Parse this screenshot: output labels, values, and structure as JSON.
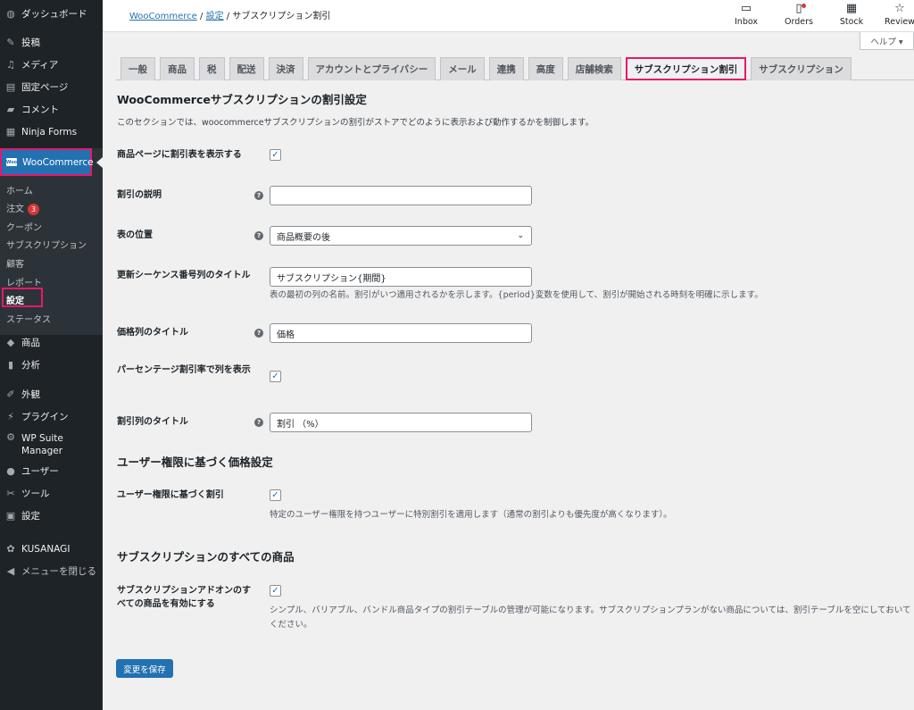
{
  "sidebar": {
    "top_items": [
      {
        "icon": "dashboard-icon",
        "label": "ダッシュボード"
      },
      {
        "icon": "pin-icon",
        "label": "投稿"
      },
      {
        "icon": "media-icon",
        "label": "メディア"
      },
      {
        "icon": "page-icon",
        "label": "固定ページ"
      },
      {
        "icon": "comment-icon",
        "label": "コメント"
      },
      {
        "icon": "forms-icon",
        "label": "Ninja Forms"
      }
    ],
    "woocommerce": {
      "label": "WooCommerce",
      "logo_text": "Woo",
      "submenu": [
        {
          "label": "ホーム"
        },
        {
          "label": "注文",
          "badge": "3"
        },
        {
          "label": "クーポン"
        },
        {
          "label": "サブスクリプション"
        },
        {
          "label": "顧客"
        },
        {
          "label": "レポート"
        },
        {
          "label": "設定",
          "current": true
        },
        {
          "label": "ステータス"
        }
      ]
    },
    "bottom_items": [
      {
        "icon": "products-icon",
        "label": "商品"
      },
      {
        "icon": "analytics-icon",
        "label": "分析"
      },
      {
        "icon": "appearance-icon",
        "label": "外観"
      },
      {
        "icon": "plugin-icon",
        "label": "プラグイン"
      },
      {
        "icon": "wp-suite-icon",
        "label": "WP Suite Manager"
      },
      {
        "icon": "users-icon",
        "label": "ユーザー"
      },
      {
        "icon": "tools-icon",
        "label": "ツール"
      },
      {
        "icon": "settings-icon",
        "label": "設定"
      },
      {
        "icon": "kusanagi-icon",
        "label": "KUSANAGI"
      },
      {
        "icon": "collapse-icon",
        "label": "メニューを閉じる"
      }
    ]
  },
  "topbar": {
    "breadcrumb": {
      "root": "WooCommerce",
      "parent": "設定",
      "current": "サブスクリプション割引",
      "sep": "/"
    },
    "buttons": [
      {
        "icon": "inbox-icon",
        "label": "Inbox"
      },
      {
        "icon": "orders-icon",
        "label": "Orders"
      },
      {
        "icon": "stock-icon",
        "label": "Stock"
      },
      {
        "icon": "star-icon",
        "label": "Review"
      }
    ],
    "help_label": "ヘルプ ▾"
  },
  "tabs": [
    {
      "label": "一般"
    },
    {
      "label": "商品"
    },
    {
      "label": "税"
    },
    {
      "label": "配送"
    },
    {
      "label": "決済"
    },
    {
      "label": "アカウントとプライバシー"
    },
    {
      "label": "メール"
    },
    {
      "label": "連携"
    },
    {
      "label": "高度"
    },
    {
      "label": "店舗検索"
    },
    {
      "label": "サブスクリプション割引",
      "active": true
    },
    {
      "label": "サブスクリプション"
    }
  ],
  "content": {
    "section1_title": "WooCommerceサブスクリプションの割引設定",
    "section1_desc": "このセクションでは、woocommerceサブスクリプションの割引がストアでどのように表示および動作するかを制御します。",
    "show_table_label": "商品ページに割引表を表示する",
    "discount_desc_label": "割引の説明",
    "discount_desc_value": "",
    "table_pos_label": "表の位置",
    "table_pos_value": "商品概要の後",
    "renewal_label": "更新シーケンス番号列のタイトル",
    "renewal_value": "サブスクリプション{期間}",
    "renewal_desc": "表の最初の列の名前。割引がいつ適用されるかを示します。{period}変数を使用して、割引が開始される時刻を明確に示します。",
    "price_col_label": "価格列のタイトル",
    "price_col_value": "価格",
    "percent_label": "パーセンテージ割引率で列を表示",
    "discount_col_label": "割引列のタイトル",
    "discount_col_value": "割引 （%）",
    "section2_title": "ユーザー権限に基づく価格設定",
    "role_label": "ユーザー権限に基づく割引",
    "role_desc": "特定のユーザー権限を持つユーザーに特別割引を適用します（通常の割引よりも優先度が高くなります）。",
    "section3_title": "サブスクリプションのすべての商品",
    "all_products_label": "サブスクリプションアドオンのすべての商品を有効にする",
    "all_products_desc": "シンプル、バリアブル、バンドル商品タイプの割引テーブルの管理が可能になります。サブスクリプションプランがない商品については、割引テーブルを空にしておいてください。",
    "help_glyph": "?",
    "check_glyph": "✓",
    "select_arrow": "⌄",
    "save_label": "変更を保存"
  }
}
